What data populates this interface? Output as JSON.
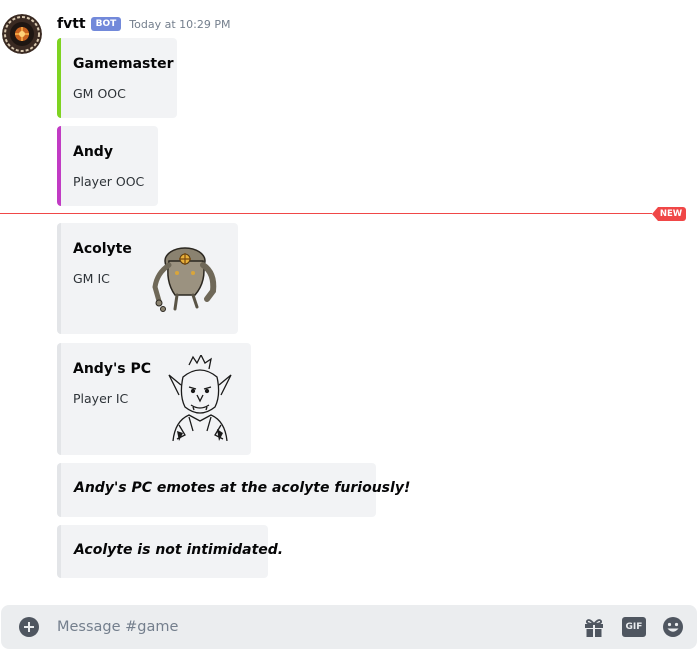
{
  "message": {
    "author": "fvtt",
    "bot_tag": "BOT",
    "timestamp": "Today at 10:29 PM"
  },
  "embeds": [
    {
      "title": "Gamemaster",
      "description": "GM OOC",
      "accent": "#7ed321"
    },
    {
      "title": "Andy",
      "description": "Player OOC",
      "accent": "#c13bc4"
    },
    {
      "title": "Acolyte",
      "description": "GM IC",
      "accent": "#e3e5e8",
      "thumbnail": "armored-acolyte-token"
    },
    {
      "title": "Andy's PC",
      "description": "Player IC",
      "accent": "#e3e5e8",
      "thumbnail": "goblin-sketch-portrait"
    },
    {
      "emote": "Andy's PC emotes at the acolyte furiously!",
      "accent": "#e3e5e8"
    },
    {
      "emote": "Acolyte is not intimidated.",
      "accent": "#e3e5e8"
    }
  ],
  "new_divider": {
    "label": "NEW",
    "color": "#f04747"
  },
  "composer": {
    "placeholder": "Message #game",
    "gif_label": "GIF",
    "icons": [
      "add-attachment-icon",
      "gift-icon",
      "gif-icon",
      "emoji-icon"
    ]
  },
  "colors": {
    "bot_tag": "#7289da",
    "embed_background": "#f2f3f5",
    "new_messages": "#f04747"
  }
}
